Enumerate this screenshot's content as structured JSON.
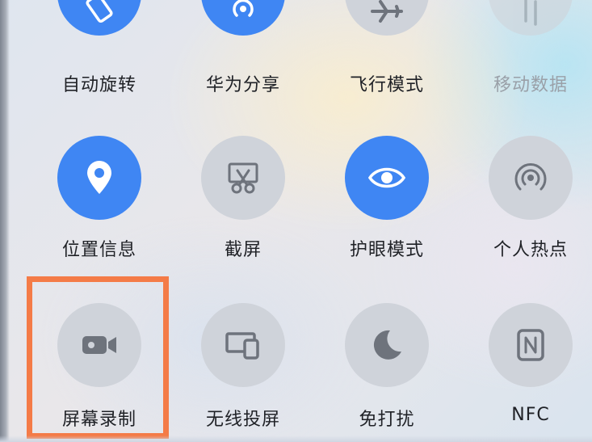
{
  "quick_settings": {
    "row1": [
      {
        "label": "自动旋转",
        "state": "on",
        "icon": "auto-rotate-icon"
      },
      {
        "label": "华为分享",
        "state": "on",
        "icon": "huawei-share-icon"
      },
      {
        "label": "飞行模式",
        "state": "off",
        "icon": "airplane-icon"
      },
      {
        "label": "移动数据",
        "state": "disabled",
        "icon": "mobile-data-icon"
      }
    ],
    "row2": [
      {
        "label": "位置信息",
        "state": "on",
        "icon": "location-pin-icon"
      },
      {
        "label": "截屏",
        "state": "off",
        "icon": "screenshot-scissors-icon"
      },
      {
        "label": "护眼模式",
        "state": "on",
        "icon": "eye-icon"
      },
      {
        "label": "个人热点",
        "state": "off",
        "icon": "hotspot-icon"
      }
    ],
    "row3": [
      {
        "label": "屏幕录制",
        "state": "off",
        "icon": "video-camera-icon"
      },
      {
        "label": "无线投屏",
        "state": "off",
        "icon": "wireless-projection-icon"
      },
      {
        "label": "免打扰",
        "state": "off",
        "icon": "moon-icon"
      },
      {
        "label": "NFC",
        "state": "off",
        "icon": "nfc-icon"
      }
    ]
  },
  "colors": {
    "active": "#3f86f3",
    "inactive": "#cfd3da",
    "highlight_border": "#f47b47"
  }
}
